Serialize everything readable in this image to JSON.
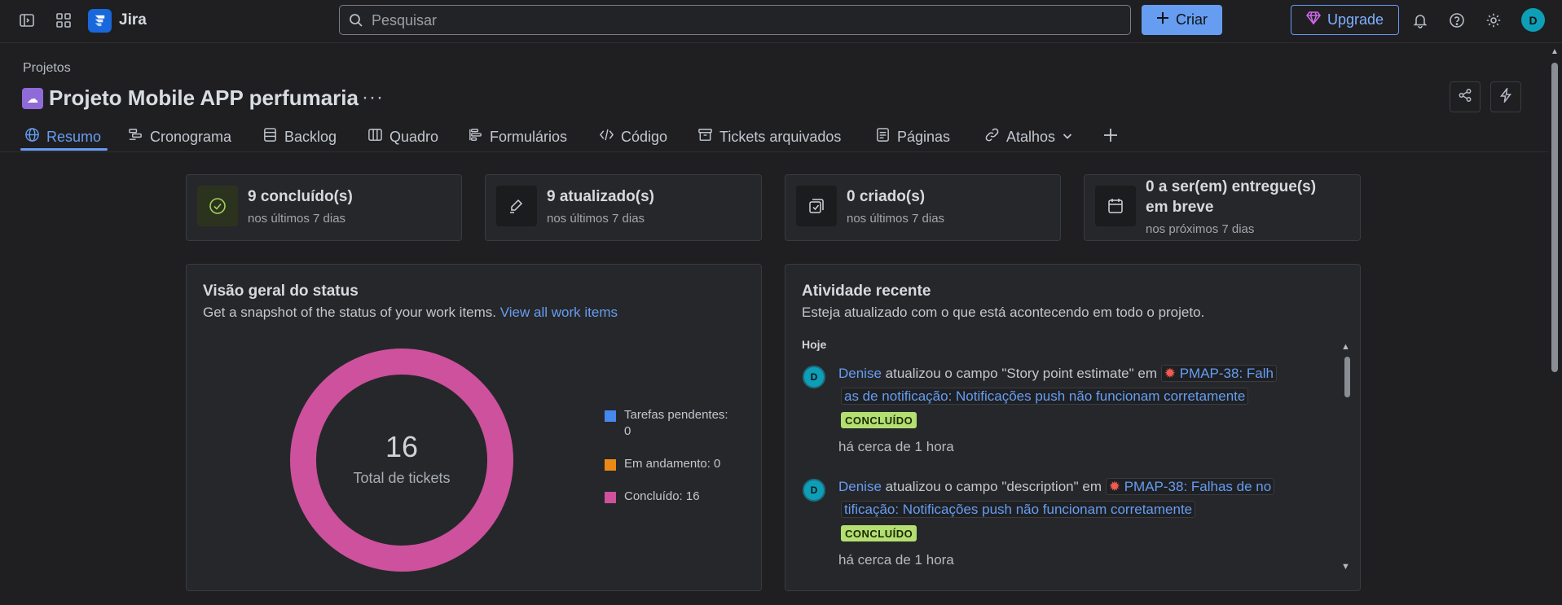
{
  "topbar": {
    "app_name": "Jira",
    "search_placeholder": "Pesquisar",
    "create_label": "Criar",
    "upgrade_label": "Upgrade",
    "avatar_initial": "D"
  },
  "project": {
    "breadcrumb": "Projetos",
    "title": "Projeto Mobile APP perfumaria",
    "more": "···"
  },
  "tabs": [
    {
      "label": "Resumo",
      "icon": "globe-icon",
      "active": true
    },
    {
      "label": "Cronograma",
      "icon": "timeline-icon"
    },
    {
      "label": "Backlog",
      "icon": "backlog-icon"
    },
    {
      "label": "Quadro",
      "icon": "board-icon"
    },
    {
      "label": "Formulários",
      "icon": "forms-icon"
    },
    {
      "label": "Código",
      "icon": "code-icon"
    },
    {
      "label": "Tickets arquivados",
      "icon": "archive-icon"
    },
    {
      "label": "Páginas",
      "icon": "pages-icon"
    },
    {
      "label": "Atalhos",
      "icon": "link-icon"
    }
  ],
  "stats": [
    {
      "title": "9 concluído(s)",
      "subtitle": "nos últimos 7 dias",
      "icon": "check-circle-icon"
    },
    {
      "title": "9 atualizado(s)",
      "subtitle": "nos últimos 7 dias",
      "icon": "edit-icon"
    },
    {
      "title": "0 criado(s)",
      "subtitle": "nos últimos 7 dias",
      "icon": "create-icon"
    },
    {
      "title_line1": "0 a ser(em) entregue(s)",
      "title_line2": "em breve",
      "subtitle": "nos próximos 7 dias",
      "icon": "calendar-icon"
    }
  ],
  "status_overview": {
    "title": "Visão geral do status",
    "subtitle": "Get a snapshot of the status of your work items.",
    "link": "View all work items",
    "total": "16",
    "total_label": "Total de tickets",
    "legend": [
      {
        "label_line1": "Tarefas pendentes:",
        "label_line2": "0",
        "color": "#4688ec"
      },
      {
        "label": "Em andamento: 0",
        "color": "#e98a17"
      },
      {
        "label": "Concluído: 16",
        "color": "#cd519d"
      }
    ]
  },
  "chart_data": {
    "type": "pie",
    "categories": [
      "Tarefas pendentes",
      "Em andamento",
      "Concluído"
    ],
    "values": [
      0,
      0,
      16
    ],
    "colors": [
      "#4688ec",
      "#e98a17",
      "#cd519d"
    ],
    "center_value": "16",
    "center_label": "Total de tickets"
  },
  "activity": {
    "title": "Atividade recente",
    "subtitle": "Esteja atualizado com o que está acontecendo em todo o projeto.",
    "day": "Hoje",
    "items": [
      {
        "user": "Denise",
        "action": "atualizou o campo \"Story point estimate\" em",
        "ticket_line1": "PMAP-38: Falh",
        "ticket_line2": "as de notificação: Notificações push não funcionam corretamente",
        "status": "CONCLUÍDO",
        "time": "há cerca de 1 hora"
      },
      {
        "user": "Denise",
        "action": "atualizou o campo \"description\" em",
        "ticket_line1": "PMAP-38: Falhas de no",
        "ticket_line2": "tificação: Notificações push não funcionam corretamente",
        "status": "CONCLUÍDO",
        "time": "há cerca de 1 hora"
      }
    ]
  }
}
